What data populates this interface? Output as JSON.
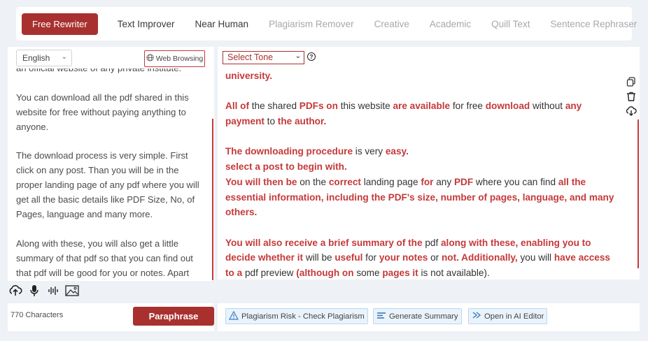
{
  "modes": [
    {
      "label": "Free Rewriter",
      "state": "active"
    },
    {
      "label": "Text Improver",
      "state": "dark"
    },
    {
      "label": "Near Human",
      "state": "dark"
    },
    {
      "label": "Plagiarism Remover",
      "state": "light"
    },
    {
      "label": "Creative",
      "state": "light"
    },
    {
      "label": "Academic",
      "state": "light"
    },
    {
      "label": "Quill Text",
      "state": "light"
    },
    {
      "label": "Sentence Rephraser",
      "state": "light"
    }
  ],
  "left": {
    "language": "English",
    "web_browsing": "Web Browsing",
    "paragraphs": [
      "an official website of any private institute.",
      "You can download all the pdf shared in this website for free without paying anything to anyone.",
      "The download process is very simple. First click on any post. Than you will be in the proper landing page of any pdf where you will get all the basic details like PDF Size, No, of Pages, language and many more.",
      "Along with these, you will also get a little summary of that pdf so that you can find out that pdf will be good for you or notes. Apart from these, you will also get a"
    ],
    "char_count": "770 Characters",
    "paraphrase": "Paraphrase"
  },
  "right": {
    "tone": "Select Tone",
    "help": "?",
    "paragraphs": [
      [
        {
          "t": "university.",
          "h": true
        }
      ],
      [
        {
          "t": "All of",
          "h": true
        },
        {
          "t": " the shared ",
          "h": false
        },
        {
          "t": "PDFs on",
          "h": true
        },
        {
          "t": " this website ",
          "h": false
        },
        {
          "t": "are available",
          "h": true
        },
        {
          "t": " for free ",
          "h": false
        },
        {
          "t": "download",
          "h": true
        },
        {
          "t": " without ",
          "h": false
        },
        {
          "t": "any payment",
          "h": true
        },
        {
          "t": " to ",
          "h": false
        },
        {
          "t": "the author.",
          "h": true
        }
      ],
      [
        {
          "t": "The downloading procedure",
          "h": true
        },
        {
          "t": " is very ",
          "h": false
        },
        {
          "t": "easy.",
          "h": true
        },
        {
          "t": "\nselect a post to begin with.",
          "h": true
        },
        {
          "t": "\nYou will then be",
          "h": true
        },
        {
          "t": " on the ",
          "h": false
        },
        {
          "t": "correct",
          "h": true
        },
        {
          "t": " landing page ",
          "h": false
        },
        {
          "t": "for",
          "h": true
        },
        {
          "t": " any ",
          "h": false
        },
        {
          "t": "PDF",
          "h": true
        },
        {
          "t": " where you can find ",
          "h": false
        },
        {
          "t": "all the essential information, including the PDF's size, number of pages, language, and many others.",
          "h": true
        }
      ],
      [
        {
          "t": "You will also receive a brief summary of the",
          "h": true
        },
        {
          "t": " pdf ",
          "h": false
        },
        {
          "t": "along with these, enabling you to decide whether it",
          "h": true
        },
        {
          "t": " will be ",
          "h": false
        },
        {
          "t": "useful",
          "h": true
        },
        {
          "t": " for ",
          "h": false
        },
        {
          "t": "your notes",
          "h": true
        },
        {
          "t": " or ",
          "h": false
        },
        {
          "t": "not. Additionally,",
          "h": true
        },
        {
          "t": " you will ",
          "h": false
        },
        {
          "t": "have access to a",
          "h": true
        },
        {
          "t": " pdf preview ",
          "h": false
        },
        {
          "t": "(although on",
          "h": true
        },
        {
          "t": " some ",
          "h": false
        },
        {
          "t": "pages it",
          "h": true
        },
        {
          "t": " is not available).",
          "h": false
        }
      ]
    ],
    "actions": [
      "Plagiarism Risk - Check Plagiarism",
      "Generate Summary",
      "Open in AI Editor"
    ]
  },
  "colors": {
    "accent": "#a8312f",
    "highlight": "#c5393a",
    "action_bg": "#eaf3fb"
  },
  "icons": [
    "upload-icon",
    "mic-icon",
    "audio-wave-icon",
    "image-icon",
    "copy-icon",
    "trash-icon",
    "download-cloud-icon",
    "warning-icon",
    "summary-icon",
    "ai-editor-icon",
    "globe-icon"
  ]
}
